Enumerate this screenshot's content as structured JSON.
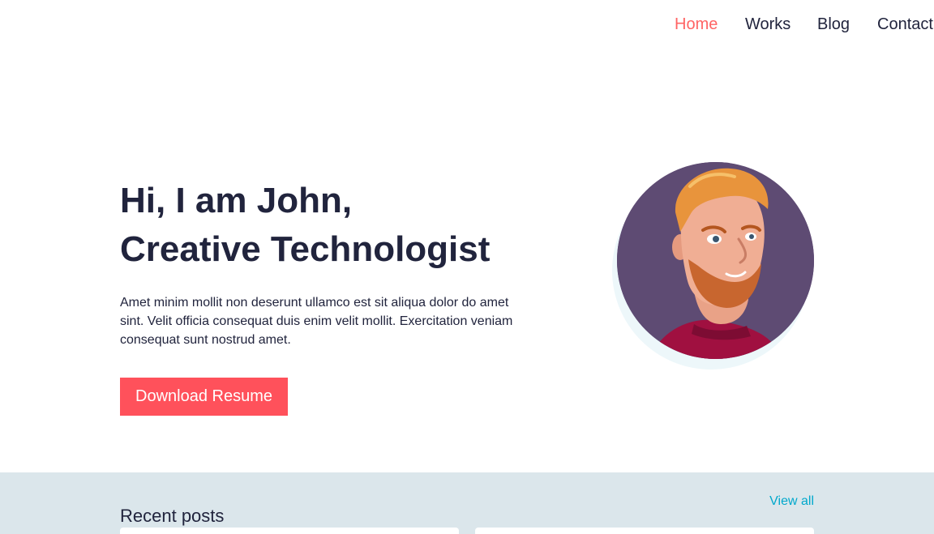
{
  "nav": {
    "items": [
      {
        "label": "Home",
        "active": true
      },
      {
        "label": "Works",
        "active": false
      },
      {
        "label": "Blog",
        "active": false
      },
      {
        "label": "Contact",
        "active": false
      }
    ]
  },
  "hero": {
    "title_line1": "Hi, I am John,",
    "title_line2": "Creative Technologist",
    "description": "Amet minim mollit non deserunt ullamco est sit aliqua dolor do amet sint. Velit officia consequat duis enim velit mollit. Exercitation veniam consequat sunt nostrud amet.",
    "cta_label": "Download Resume"
  },
  "recent": {
    "title": "Recent posts",
    "view_all_label": "View all"
  },
  "colors": {
    "accent": "#ff6464",
    "button": "#ff515b",
    "heading": "#21243d",
    "link": "#00a8cc",
    "section_bg": "#dbe6eb",
    "avatar_bg": "#5e4b73"
  },
  "icons": {
    "avatar": "portrait-illustration"
  }
}
